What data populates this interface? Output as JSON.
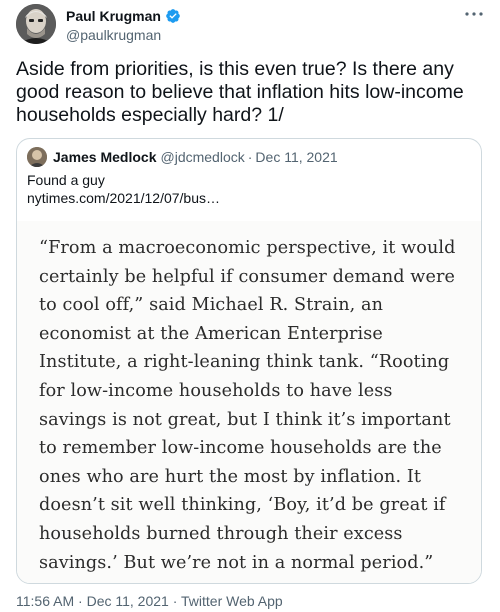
{
  "author": {
    "name": "Paul Krugman",
    "handle": "@paulkrugman",
    "verified": true
  },
  "tweet_text": "Aside from priorities, is this even true? Is there any good reason to believe that inflation hits low-income households especially hard? 1/",
  "quoted_tweet": {
    "author_name": "James Medlock",
    "author_handle": "@jdcmedlock",
    "separator": "·",
    "date": "Dec 11, 2021",
    "text_line1": "Found a guy",
    "text_line2": "nytimes.com/2021/12/07/bus…",
    "image_text_lines": [
      "“From a macroeconomic perspective, it would",
      "certainly be helpful if consumer demand were",
      "to cool off,” said Michael R. Strain, an",
      "economist at the American Enterprise",
      "Institute, a right-leaning think tank. “Rooting",
      "for low-income households to have less",
      "savings is not great, but I think it’s important",
      "to remember low-income households are the",
      "ones who are hurt the most by inflation. It",
      "doesn’t sit well thinking, ‘Boy, it’d be great if",
      "households burned through their excess",
      "savings.’ But we’re not in a normal period.”"
    ]
  },
  "meta": {
    "time": "11:56 AM",
    "separator": "·",
    "date": "Dec 11, 2021",
    "source": "Twitter Web App"
  },
  "icons": {
    "verified": "verified-badge-icon",
    "more": "more-options-icon"
  },
  "colors": {
    "verified_blue": "#1d9bf0",
    "secondary_text": "#536471",
    "border": "#cfd9de"
  }
}
